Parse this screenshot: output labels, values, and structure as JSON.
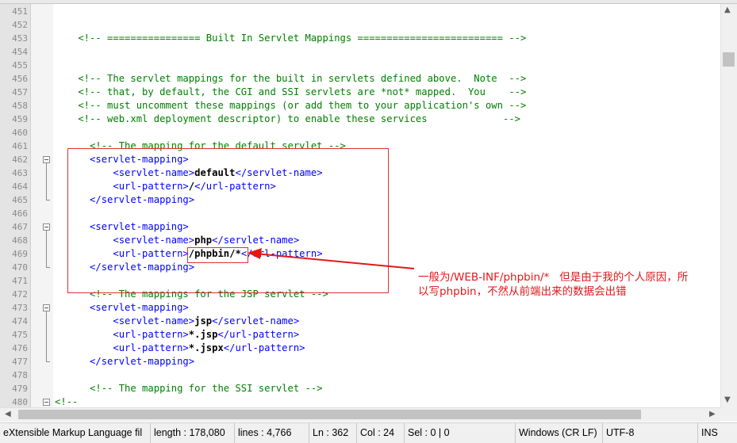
{
  "editor": {
    "lines": [
      {
        "num": "451",
        "html": ""
      },
      {
        "num": "452",
        "html": ""
      },
      {
        "num": "453",
        "segs": [
          [
            "cm",
            "    <!-- ================ Built In Servlet Mappings ========================= -->"
          ]
        ]
      },
      {
        "num": "454",
        "html": ""
      },
      {
        "num": "455",
        "html": ""
      },
      {
        "num": "456",
        "segs": [
          [
            "cm",
            "    <!-- The servlet mappings for the built in servlets defined above.  Note  -->"
          ]
        ]
      },
      {
        "num": "457",
        "segs": [
          [
            "cm",
            "    <!-- that, by default, the CGI and SSI servlets are *not* mapped.  You    -->"
          ]
        ]
      },
      {
        "num": "458",
        "segs": [
          [
            "cm",
            "    <!-- must uncomment these mappings (or add them to your application's own -->"
          ]
        ]
      },
      {
        "num": "459",
        "segs": [
          [
            "cm",
            "    <!-- web.xml deployment descriptor) to enable these services             -->"
          ]
        ]
      },
      {
        "num": "460",
        "html": ""
      },
      {
        "num": "461",
        "segs": [
          [
            "cm",
            "      <!-- The mapping for the default servlet -->"
          ]
        ]
      },
      {
        "num": "462",
        "segs": [
          [
            "tg",
            "      <servlet-mapping>"
          ]
        ],
        "fold": "box"
      },
      {
        "num": "463",
        "segs": [
          [
            "tg",
            "          <servlet-name>"
          ],
          [
            "tx",
            "default"
          ],
          [
            "tg",
            "</servlet-name>"
          ]
        ]
      },
      {
        "num": "464",
        "segs": [
          [
            "tg",
            "          <url-pattern>"
          ],
          [
            "tx",
            "/"
          ],
          [
            "tg",
            "</url-pattern>"
          ]
        ]
      },
      {
        "num": "465",
        "segs": [
          [
            "tg",
            "      </servlet-mapping>"
          ]
        ],
        "fold": "end"
      },
      {
        "num": "466",
        "html": ""
      },
      {
        "num": "467",
        "segs": [
          [
            "tg",
            "      <servlet-mapping>"
          ]
        ],
        "fold": "box"
      },
      {
        "num": "468",
        "segs": [
          [
            "tg",
            "          <servlet-name>"
          ],
          [
            "tx",
            "php"
          ],
          [
            "tg",
            "</servlet-name>"
          ]
        ]
      },
      {
        "num": "469",
        "segs": [
          [
            "tg",
            "          <url-pattern>"
          ],
          [
            "tx",
            "/phpbin/*"
          ],
          [
            "tg",
            "</url-pattern>"
          ]
        ]
      },
      {
        "num": "470",
        "segs": [
          [
            "tg",
            "      </servlet-mapping>"
          ]
        ],
        "fold": "end"
      },
      {
        "num": "471",
        "html": ""
      },
      {
        "num": "472",
        "segs": [
          [
            "cm",
            "      <!-- The mappings for the JSP servlet -->"
          ]
        ]
      },
      {
        "num": "473",
        "segs": [
          [
            "tg",
            "      <servlet-mapping>"
          ]
        ],
        "fold": "box"
      },
      {
        "num": "474",
        "segs": [
          [
            "tg",
            "          <servlet-name>"
          ],
          [
            "tx",
            "jsp"
          ],
          [
            "tg",
            "</servlet-name>"
          ]
        ]
      },
      {
        "num": "475",
        "segs": [
          [
            "tg",
            "          <url-pattern>"
          ],
          [
            "tx",
            "*.jsp"
          ],
          [
            "tg",
            "</url-pattern>"
          ]
        ]
      },
      {
        "num": "476",
        "segs": [
          [
            "tg",
            "          <url-pattern>"
          ],
          [
            "tx",
            "*.jspx"
          ],
          [
            "tg",
            "</url-pattern>"
          ]
        ]
      },
      {
        "num": "477",
        "segs": [
          [
            "tg",
            "      </servlet-mapping>"
          ]
        ],
        "fold": "end"
      },
      {
        "num": "478",
        "html": ""
      },
      {
        "num": "479",
        "segs": [
          [
            "cm",
            "      <!-- The mapping for the SSI servlet -->"
          ]
        ]
      },
      {
        "num": "480",
        "segs": [
          [
            "cm",
            "<!--"
          ]
        ],
        "fold": "box"
      }
    ]
  },
  "annotation": {
    "line1": "一般为/WEB-INF/phpbin/*   但是由于我的个人原因，所",
    "line2": "以写phpbin，不然从前端出来的数据会出错"
  },
  "scrollbar": {
    "up_icon": "▲",
    "down_icon": "▼",
    "left_icon": "◀",
    "right_icon": "▶"
  },
  "status": {
    "filetype": "eXtensible Markup Language fil",
    "length": "length : 178,080",
    "lines": "lines : 4,766",
    "ln": "Ln : 362",
    "col": "Col : 24",
    "sel": "Sel : 0 | 0",
    "eol": "Windows (CR LF)",
    "encoding": "UTF-8",
    "mode": "INS"
  },
  "colors": {
    "comment": "#008000",
    "tag": "#0000ff",
    "annotation": "#e0181a"
  }
}
